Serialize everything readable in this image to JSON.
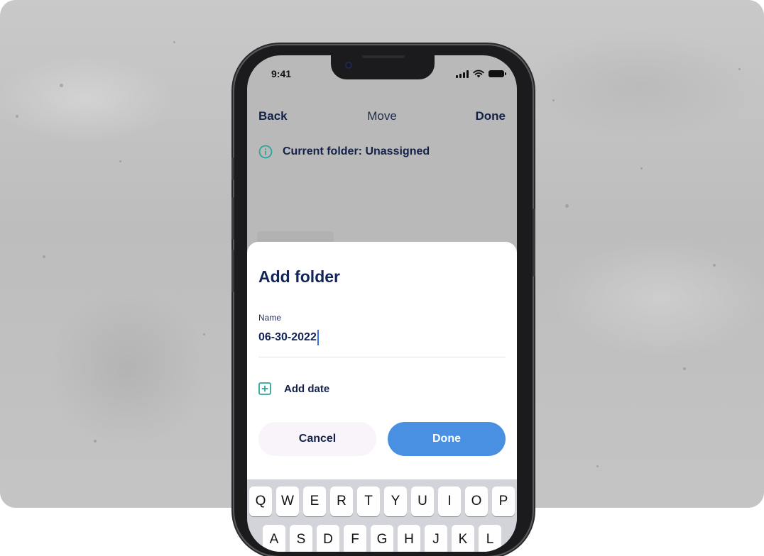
{
  "status_bar": {
    "time": "9:41"
  },
  "nav": {
    "back_label": "Back",
    "title": "Move",
    "done_label": "Done"
  },
  "current_folder": {
    "icon": "info-circle-icon",
    "text": "Current folder: Unassigned"
  },
  "sheet": {
    "title": "Add folder",
    "name_label": "Name",
    "name_value": "06-30-2022",
    "add_date_icon": "plus-square-icon",
    "add_date_label": "Add date",
    "cancel_label": "Cancel",
    "done_label": "Done"
  },
  "keyboard": {
    "row1": [
      "Q",
      "W",
      "E",
      "R",
      "T",
      "Y",
      "U",
      "I",
      "O",
      "P"
    ],
    "row2": [
      "A",
      "S",
      "D",
      "F",
      "G",
      "H",
      "J",
      "K",
      "L"
    ]
  },
  "colors": {
    "accent": "#4a90e2",
    "info_icon": "#2aa59a",
    "text_dark": "#14224a"
  }
}
